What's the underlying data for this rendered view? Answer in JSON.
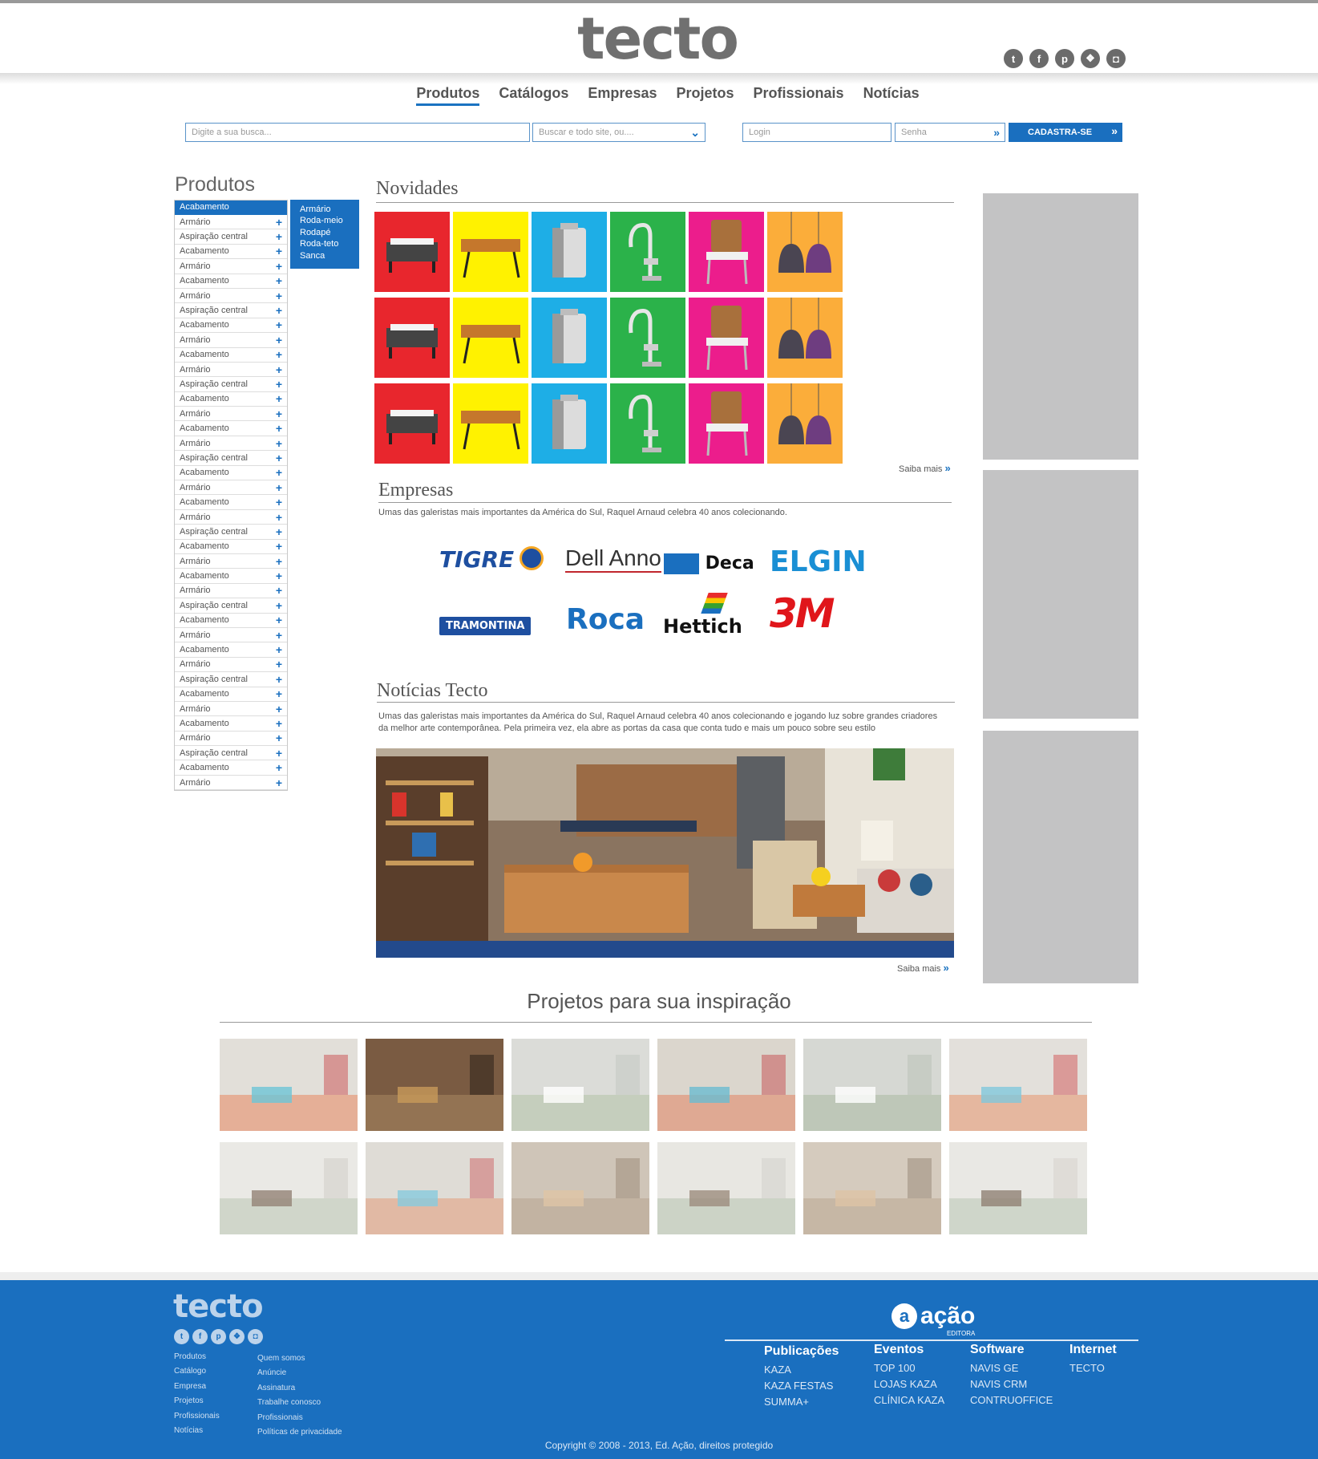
{
  "header": {
    "logo": "tecto",
    "social": [
      "twitter-icon",
      "facebook-icon",
      "pinterest-icon",
      "dropbox-icon",
      "instagram-icon"
    ]
  },
  "nav": [
    {
      "label": "Produtos",
      "active": true
    },
    {
      "label": "Catálogos"
    },
    {
      "label": "Empresas"
    },
    {
      "label": "Projetos"
    },
    {
      "label": "Profissionais"
    },
    {
      "label": "Notícias"
    }
  ],
  "search": {
    "placeholder": "Digite a sua busca...",
    "scope_placeholder": "Buscar e todo site, ou....",
    "login_placeholder": "Login",
    "password_placeholder": "Senha",
    "register_label": "CADASTRA-SE"
  },
  "sidebar": {
    "title": "Produtos",
    "selected": "Acabamento",
    "items": [
      "Armário",
      "Aspiração central",
      "Acabamento",
      "Armário",
      "Acabamento",
      "Armário",
      "Aspiração central",
      "Acabamento",
      "Armário",
      "Acabamento",
      "Armário",
      "Aspiração central",
      "Acabamento",
      "Armário",
      "Acabamento",
      "Armário",
      "Aspiração central",
      "Acabamento",
      "Armário",
      "Acabamento",
      "Armário",
      "Aspiração central",
      "Acabamento",
      "Armário",
      "Acabamento",
      "Armário",
      "Aspiração central",
      "Acabamento",
      "Armário",
      "Acabamento",
      "Armário",
      "Aspiração central",
      "Acabamento",
      "Armário",
      "Acabamento",
      "Armário",
      "Aspiração central",
      "Acabamento",
      "Armário"
    ],
    "flyout": [
      "Armário",
      "Roda-meio",
      "Rodapé",
      "Roda-teto",
      "Sanca"
    ]
  },
  "novidades": {
    "title": "Novidades",
    "tile_colors": [
      "#e8262d",
      "#fff200",
      "#1eaee6",
      "#2bb24a",
      "#ec1d8c",
      "#fbad3a"
    ],
    "more": "Saiba mais"
  },
  "empresas": {
    "title": "Empresas",
    "description": "Umas das galeristas mais importantes da América do Sul, Raquel Arnaud celebra 40 anos colecionando.",
    "brands": [
      "TIGRE",
      "Dell Anno",
      "Deca",
      "ELGIN",
      "TRAMONTINA",
      "Roca",
      "Hettich",
      "3M"
    ]
  },
  "noticias": {
    "title": "Notícias Tecto",
    "description1": "Umas das galeristas mais importantes da América do Sul, Raquel Arnaud celebra 40 anos colecionando e jogando luz sobre grandes criadores",
    "description2": "da melhor arte contemporânea. Pela primeira vez, ela abre as portas da casa que conta tudo e mais um pouco sobre seu estilo",
    "more": "Saiba mais"
  },
  "inspiracao": {
    "title": "Projetos para sua inspiração"
  },
  "footer": {
    "logo": "tecto",
    "links_left": [
      "Produtos",
      "Catálogo",
      "Empresa",
      "Projetos",
      "Profissionais",
      "Notícias"
    ],
    "links_right": [
      "Quem somos",
      "Anúncie",
      "Assinatura",
      "Trabalhe conosco",
      "Profissionais",
      "Políticas de privacidade"
    ],
    "acao_logo": "ação",
    "acao_sub": "EDITORA",
    "columns": [
      {
        "heading": "Publicações",
        "items": [
          "KAZA",
          "KAZA FESTAS",
          "SUMMA+"
        ]
      },
      {
        "heading": "Eventos",
        "items": [
          "TOP 100",
          "LOJAS KAZA",
          "CLÍNICA KAZA"
        ]
      },
      {
        "heading": "Software",
        "items": [
          "NAVIS GE",
          "NAVIS CRM",
          "CONTRUOFFICE"
        ]
      },
      {
        "heading": "Internet",
        "items": [
          "TECTO"
        ]
      }
    ],
    "copyright": "Copyright © 2008 - 2013, Ed. Ação, direitos protegido"
  }
}
